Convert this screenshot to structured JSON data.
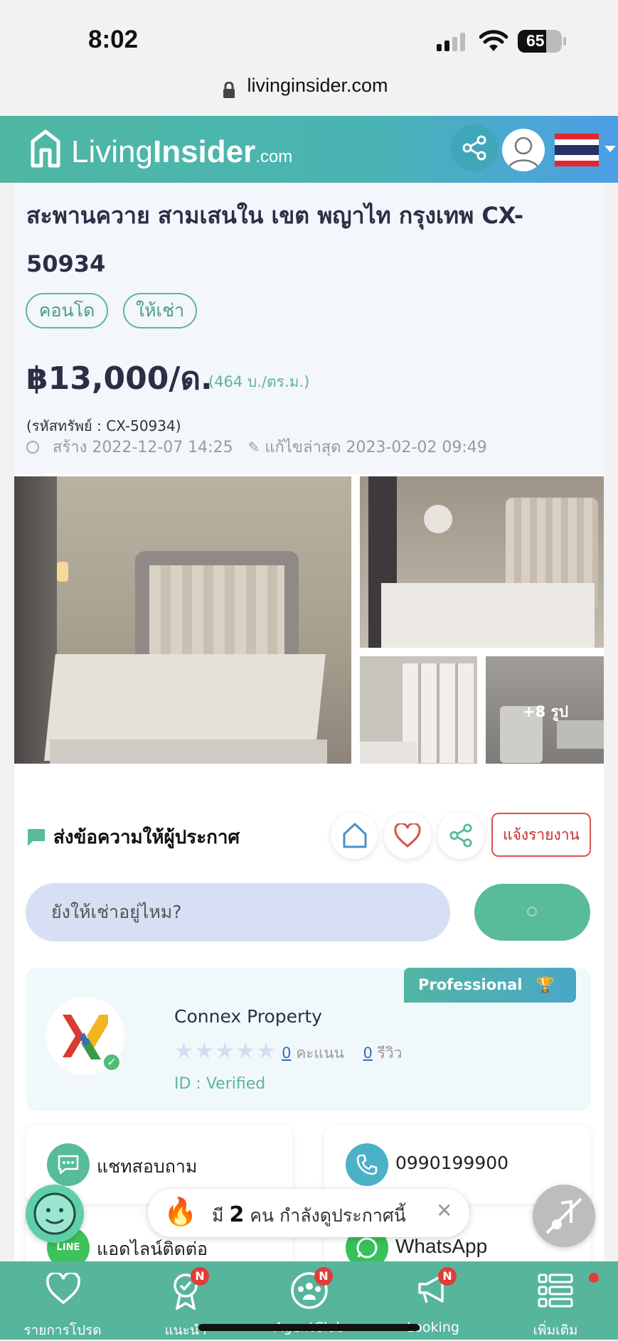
{
  "status": {
    "time": "8:02",
    "battery": "65"
  },
  "browser": {
    "url": "livinginsider.com"
  },
  "header": {
    "logo_living": "Living",
    "logo_insider": "Insider",
    "logo_com": ".com"
  },
  "listing": {
    "title": "สะพานควาย สามเสนใน เขต พญาไท กรุงเทพ CX-50934",
    "tags": [
      "คอนโด",
      "ให้เช่า"
    ],
    "price": "฿13,000/ด.",
    "price_per_sqm": "(464 บ./ตร.ม.)",
    "code": "(รหัสทรัพย์ : CX-50934)",
    "created": "สร้าง 2022-12-07 14:25",
    "updated": "แก้ไขล่าสุด 2023-02-02 09:49",
    "more_photos": "+8 รูป"
  },
  "message": {
    "title": "ส่งข้อความให้ผู้ประกาศ",
    "report_label": "แจ้งรายงาน",
    "input_value": "ยังให้เช่าอยู่ไหม?"
  },
  "agent": {
    "badge": "Professional",
    "name": "Connex Property",
    "score_count": "0",
    "score_label": "คะแนน",
    "review_count": "0",
    "review_label": "รีวิว",
    "verified": "ID : Verified"
  },
  "contacts": {
    "chat": "แชทสอบถาม",
    "phone": "0990199900",
    "line": "แอดไลน์ติดต่อ",
    "whatsapp": "WhatsApp"
  },
  "viewers": {
    "prefix": "มี",
    "count": "2",
    "suffix": "คน กำลังดูประกาศนี้"
  },
  "nav": {
    "items": [
      {
        "label": "รายการโปรด",
        "icon": "heart-icon"
      },
      {
        "label": "แนะนำ",
        "icon": "award-icon",
        "badge": "N"
      },
      {
        "label": "AgentClub",
        "icon": "group-icon",
        "badge": "N"
      },
      {
        "label": "Looking",
        "icon": "megaphone-icon",
        "badge": "N"
      },
      {
        "label": "เพิ่มเติม",
        "icon": "menu-grid-icon"
      }
    ]
  },
  "colors": {
    "brand_green": "#57b59c",
    "brand_blue": "#4c9ee6",
    "report_red": "#d9534f",
    "badge_red": "#e23b3b"
  }
}
